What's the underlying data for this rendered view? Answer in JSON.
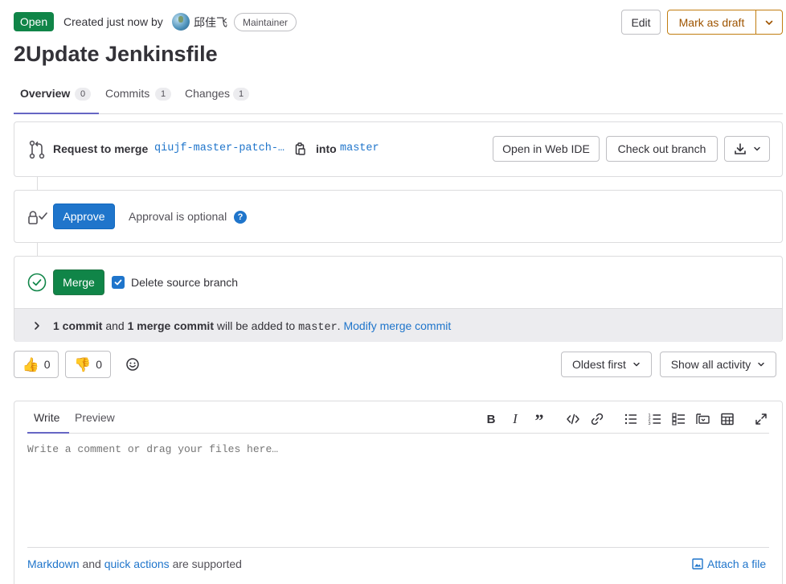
{
  "header": {
    "status_badge": "Open",
    "created_text": "Created just now by",
    "author_name": "邱佳飞",
    "author_role": "Maintainer",
    "edit_label": "Edit",
    "draft_label": "Mark as draft"
  },
  "title": "2Update Jenkinsfile",
  "tabs": [
    {
      "label": "Overview",
      "count": "0"
    },
    {
      "label": "Commits",
      "count": "1"
    },
    {
      "label": "Changes",
      "count": "1"
    }
  ],
  "merge_request": {
    "request_label": "Request to merge",
    "source_branch": "qiujf-master-patch-…",
    "into_label": "into",
    "target_branch": "master",
    "web_ide_label": "Open in Web IDE",
    "checkout_label": "Check out branch"
  },
  "approval": {
    "approve_label": "Approve",
    "optional_text": "Approval is optional"
  },
  "merge": {
    "merge_label": "Merge",
    "delete_branch_label": "Delete source branch",
    "delete_branch_checked": true,
    "commit_info": {
      "commits": "1 commit",
      "and": "and",
      "merge_commits": "1 merge commit",
      "added_to": "will be added to",
      "branch": "master",
      "period": ".",
      "modify_link": "Modify merge commit"
    }
  },
  "reactions": {
    "thumbs_up_count": "0",
    "thumbs_down_count": "0"
  },
  "sort": {
    "order_label": "Oldest first",
    "filter_label": "Show all activity"
  },
  "comment": {
    "write_tab": "Write",
    "preview_tab": "Preview",
    "placeholder": "Write a comment or drag your files here…",
    "footer_markdown": "Markdown",
    "footer_and": "and",
    "footer_quick_actions": "quick actions",
    "footer_supported": "are supported",
    "attach_label": "Attach a file"
  },
  "colors": {
    "open_green": "#108548",
    "approve_blue": "#1f75cb",
    "link_blue": "#1f75cb",
    "draft_orange": "#9e5400",
    "tab_underline": "#6666c4"
  }
}
